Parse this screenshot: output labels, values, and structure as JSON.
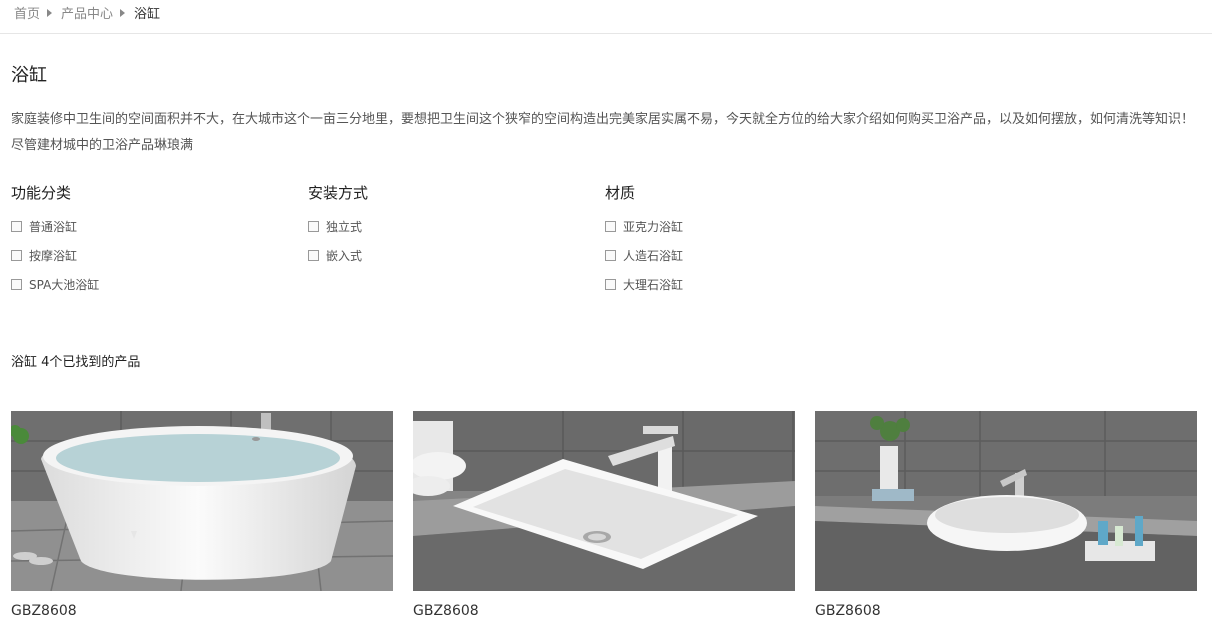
{
  "breadcrumb": {
    "home": "首页",
    "category": "产品中心",
    "current": "浴缸"
  },
  "page": {
    "title": "浴缸",
    "description": "家庭装修中卫生间的空间面积并不大，在大城市这个一亩三分地里，要想把卫生间这个狭窄的空间构造出完美家居实属不易，今天就全方位的给大家介绍如何购买卫浴产品，以及如何摆放，如何清洗等知识！尽管建材城中的卫浴产品琳琅满"
  },
  "filters": [
    {
      "heading": "功能分类",
      "options": [
        "普通浴缸",
        "按摩浴缸",
        "SPA大池浴缸"
      ]
    },
    {
      "heading": "安装方式",
      "options": [
        "独立式",
        "嵌入式"
      ]
    },
    {
      "heading": "材质",
      "options": [
        "亚克力浴缸",
        "人造石浴缸",
        "大理石浴缸"
      ]
    }
  ],
  "result_count": "浴缸 4个已找到的产品",
  "products": [
    {
      "name": "GBZ8608",
      "image": "freestanding-bathtub-photo"
    },
    {
      "name": "GBZ8608",
      "image": "rectangular-basin-photo"
    },
    {
      "name": "GBZ8608",
      "image": "oval-basin-photo"
    }
  ]
}
